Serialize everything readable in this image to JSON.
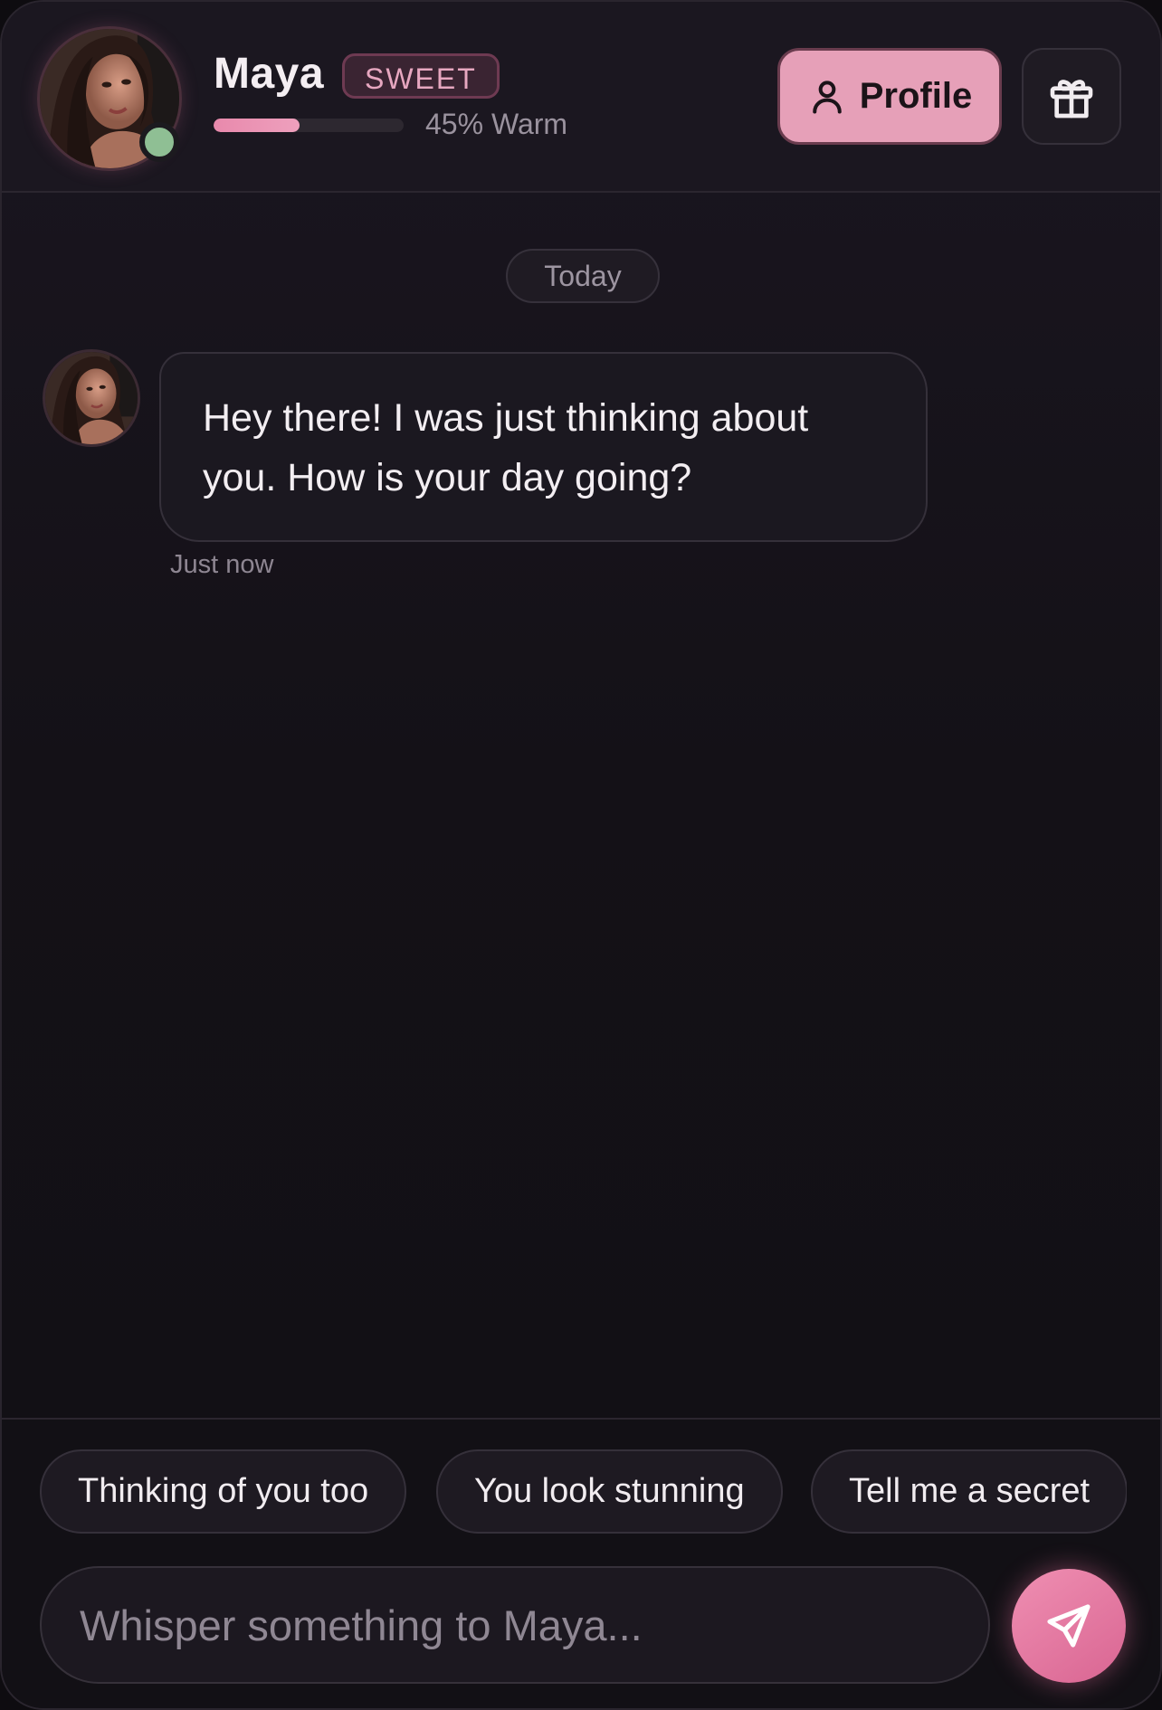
{
  "header": {
    "contact_name": "Maya",
    "mood_badge": "SWEET",
    "warmth_percent": 45,
    "warmth_label": "45% Warm",
    "online_status_color": "#8fbf94",
    "profile_label": "Profile",
    "profile_icon": "user-icon",
    "gift_icon": "gift-icon"
  },
  "chat": {
    "date_separator": "Today",
    "messages": [
      {
        "sender": "Maya",
        "text": "Hey there! I was just thinking about you. How is your day going?",
        "time": "Just now"
      }
    ]
  },
  "quick_replies": [
    "Thinking of you too",
    "You look stunning",
    "Tell me a secret"
  ],
  "composer": {
    "placeholder": "Whisper something to Maya...",
    "value": "",
    "send_icon": "send-icon"
  },
  "colors": {
    "accent": "#e6a0b8",
    "accent_strong": "#e26f9a",
    "background": "#141117"
  }
}
